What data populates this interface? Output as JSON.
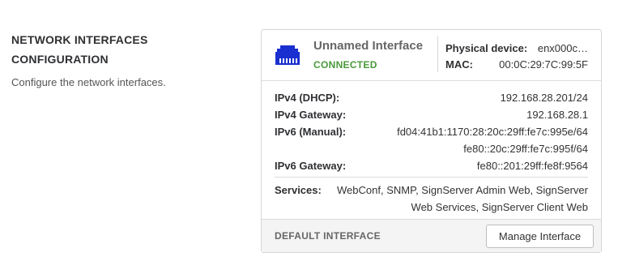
{
  "section": {
    "title_line1": "NETWORK INTERFACES",
    "title_line2": "CONFIGURATION",
    "description": "Configure the network interfaces."
  },
  "interface": {
    "name": "Unnamed Interface",
    "status": "CONNECTED",
    "status_color": "#4a9a3a",
    "icon": "ethernet-port-icon",
    "icon_color": "#1a2fcf",
    "physical_device_label": "Physical device:",
    "physical_device_value": "enx000c…",
    "mac_label": "MAC:",
    "mac_value": "00:0C:29:7C:99:5F",
    "ipv4_label": "IPv4 (DHCP):",
    "ipv4_value": "192.168.28.201/24",
    "ipv4_gateway_label": "IPv4 Gateway:",
    "ipv4_gateway_value": "192.168.28.1",
    "ipv6_label": "IPv6 (Manual):",
    "ipv6_values": [
      "fd04:41b1:1170:28:20c:29ff:fe7c:995e/64",
      "fe80::20c:29ff:fe7c:995f/64"
    ],
    "ipv6_gateway_label": "IPv6 Gateway:",
    "ipv6_gateway_value": "fe80::201:29ff:fe8f:9564",
    "services_label": "Services:",
    "services_value": "WebConf, SNMP, SignServer Admin Web, SignServer Web Services, SignServer Client Web",
    "default_label": "DEFAULT INTERFACE",
    "manage_button": "Manage Interface"
  }
}
